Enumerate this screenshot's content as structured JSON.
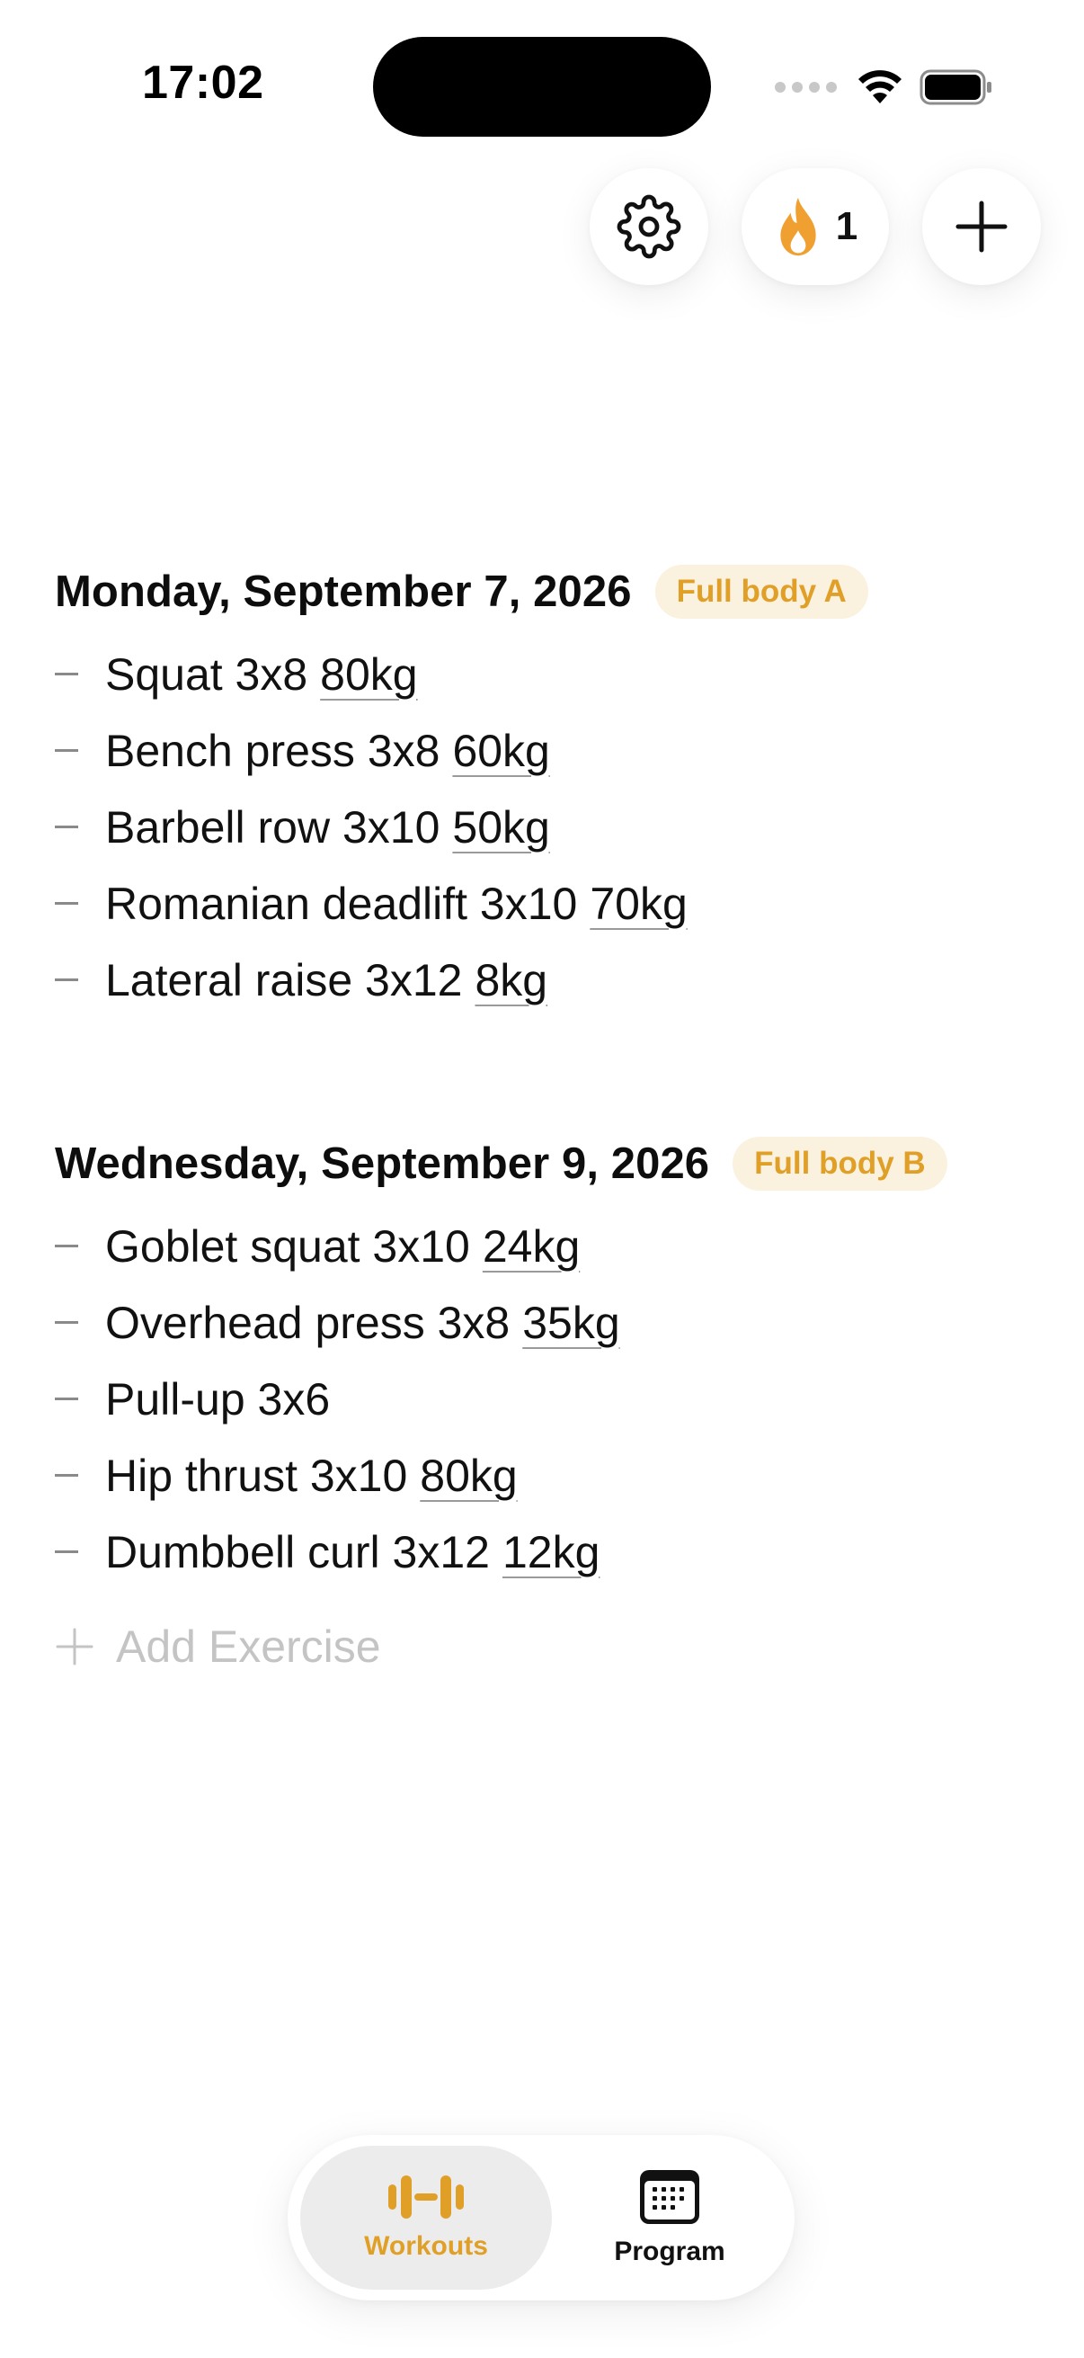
{
  "status_bar": {
    "time": "17:02"
  },
  "header": {
    "streak_count": "1"
  },
  "workouts": [
    {
      "date": "Monday, September 7, 2026",
      "tag": "Full body A",
      "exercises": [
        {
          "name": "Squat 3x8",
          "weight": "80kg"
        },
        {
          "name": "Bench press 3x8",
          "weight": "60kg"
        },
        {
          "name": "Barbell row 3x10",
          "weight": "50kg"
        },
        {
          "name": "Romanian deadlift 3x10",
          "weight": "70kg"
        },
        {
          "name": "Lateral raise 3x12",
          "weight": "8kg"
        }
      ]
    },
    {
      "date": "Wednesday, September 9, 2026",
      "tag": "Full body B",
      "exercises": [
        {
          "name": "Goblet squat 3x10",
          "weight": "24kg"
        },
        {
          "name": "Overhead press 3x8",
          "weight": "35kg"
        },
        {
          "name": "Pull-up 3x6",
          "weight": ""
        },
        {
          "name": "Hip thrust 3x10",
          "weight": "80kg"
        },
        {
          "name": "Dumbbell curl 3x12",
          "weight": "12kg"
        }
      ],
      "add_exercise_label": "Add Exercise"
    }
  ],
  "tabbar": {
    "tabs": [
      {
        "label": "Workouts",
        "icon": "dumbbell-icon",
        "active": true
      },
      {
        "label": "Program",
        "icon": "calendar-icon",
        "active": false
      }
    ]
  },
  "colors": {
    "accent": "#e0a028",
    "tag_background": "#fbf1df",
    "placeholder": "#c4c4c4"
  },
  "icons": {
    "settings": "gear-icon",
    "streak": "flame-icon",
    "add": "plus-icon"
  }
}
